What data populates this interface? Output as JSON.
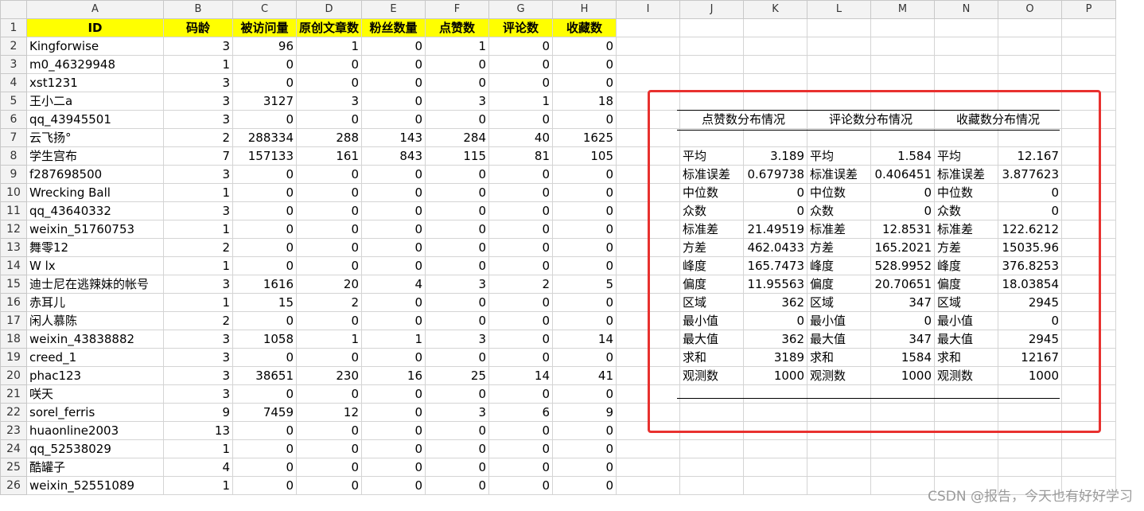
{
  "columns": [
    "A",
    "B",
    "C",
    "D",
    "E",
    "F",
    "G",
    "H",
    "I",
    "J",
    "K",
    "L",
    "M",
    "N",
    "O",
    "P"
  ],
  "header_row": [
    "ID",
    "码龄",
    "被访问量",
    "原创文章数",
    "粉丝数量",
    "点赞数",
    "评论数",
    "收藏数"
  ],
  "rows": [
    [
      "Kingforwise",
      "3",
      "96",
      "1",
      "0",
      "1",
      "0",
      "0"
    ],
    [
      "m0_46329948",
      "1",
      "0",
      "0",
      "0",
      "0",
      "0",
      "0"
    ],
    [
      "xst1231",
      "3",
      "0",
      "0",
      "0",
      "0",
      "0",
      "0"
    ],
    [
      "王小二a",
      "3",
      "3127",
      "3",
      "0",
      "3",
      "1",
      "18"
    ],
    [
      "qq_43945501",
      "3",
      "0",
      "0",
      "0",
      "0",
      "0",
      "0"
    ],
    [
      "云飞扬°",
      "2",
      "288334",
      "288",
      "143",
      "284",
      "40",
      "1625"
    ],
    [
      "学生宫布",
      "7",
      "157133",
      "161",
      "843",
      "115",
      "81",
      "105"
    ],
    [
      "f287698500",
      "3",
      "0",
      "0",
      "0",
      "0",
      "0",
      "0"
    ],
    [
      "Wrecking Ball",
      "1",
      "0",
      "0",
      "0",
      "0",
      "0",
      "0"
    ],
    [
      "qq_43640332",
      "3",
      "0",
      "0",
      "0",
      "0",
      "0",
      "0"
    ],
    [
      "weixin_51760753",
      "1",
      "0",
      "0",
      "0",
      "0",
      "0",
      "0"
    ],
    [
      "舞零12",
      "2",
      "0",
      "0",
      "0",
      "0",
      "0",
      "0"
    ],
    [
      "W lx",
      "1",
      "0",
      "0",
      "0",
      "0",
      "0",
      "0"
    ],
    [
      "迪士尼在逃辣妹的帐号",
      "3",
      "1616",
      "20",
      "4",
      "3",
      "2",
      "5"
    ],
    [
      "赤耳儿",
      "1",
      "15",
      "2",
      "0",
      "0",
      "0",
      "0"
    ],
    [
      "闲人慕陈",
      "2",
      "0",
      "0",
      "0",
      "0",
      "0",
      "0"
    ],
    [
      "weixin_43838882",
      "3",
      "1058",
      "1",
      "1",
      "3",
      "0",
      "14"
    ],
    [
      "creed_1",
      "3",
      "0",
      "0",
      "0",
      "0",
      "0",
      "0"
    ],
    [
      "phac123",
      "3",
      "38651",
      "230",
      "16",
      "25",
      "14",
      "41"
    ],
    [
      "咲天",
      "3",
      "0",
      "0",
      "0",
      "0",
      "0",
      "0"
    ],
    [
      "sorel_ferris",
      "9",
      "7459",
      "12",
      "0",
      "3",
      "6",
      "9"
    ],
    [
      "huaonline2003",
      "13",
      "0",
      "0",
      "0",
      "0",
      "0",
      "0"
    ],
    [
      "qq_52538029",
      "1",
      "0",
      "0",
      "0",
      "0",
      "0",
      "0"
    ],
    [
      "酷罐子",
      "4",
      "0",
      "0",
      "0",
      "0",
      "0",
      "0"
    ],
    [
      "weixin_52551089",
      "1",
      "0",
      "0",
      "0",
      "0",
      "0",
      "0"
    ]
  ],
  "stats": {
    "titles": [
      "点赞数分布情况",
      "评论数分布情况",
      "收藏数分布情况"
    ],
    "labels": [
      "平均",
      "标准误差",
      "中位数",
      "众数",
      "标准差",
      "方差",
      "峰度",
      "偏度",
      "区域",
      "最小值",
      "最大值",
      "求和",
      "观测数"
    ],
    "values": [
      [
        "3.189",
        "0.679738",
        "0",
        "0",
        "21.49519",
        "462.0433",
        "165.7473",
        "11.95563",
        "362",
        "0",
        "362",
        "3189",
        "1000"
      ],
      [
        "1.584",
        "0.406451",
        "0",
        "0",
        "12.8531",
        "165.2021",
        "528.9952",
        "20.70651",
        "347",
        "0",
        "347",
        "1584",
        "1000"
      ],
      [
        "12.167",
        "3.877623",
        "0",
        "0",
        "122.6212",
        "15035.96",
        "376.8253",
        "18.03854",
        "2945",
        "0",
        "2945",
        "12167",
        "1000"
      ]
    ]
  },
  "watermark": "CSDN @报告，今天也有好好学习",
  "colors": {
    "header_fill": "#ffff00",
    "highlight_box": "#e8312f"
  }
}
